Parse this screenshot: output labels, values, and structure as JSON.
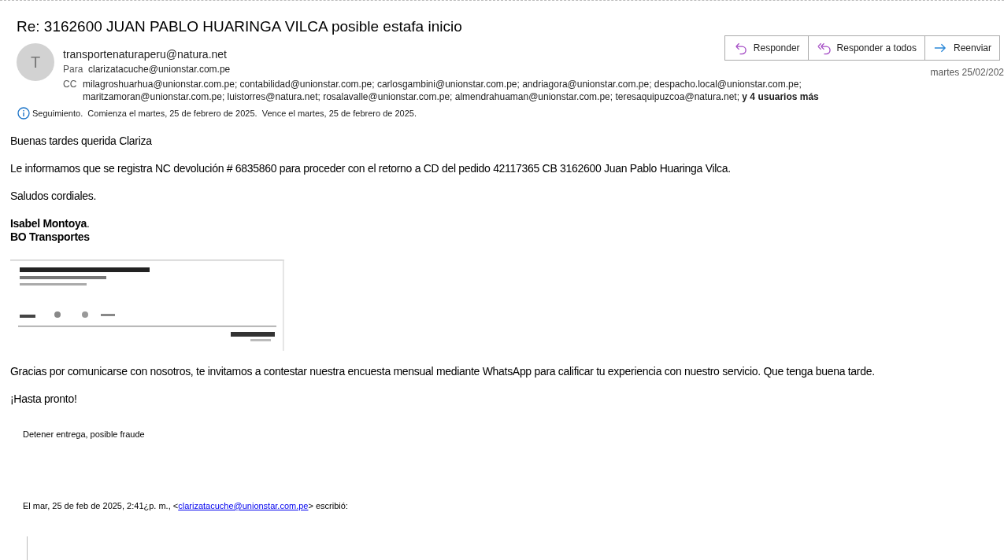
{
  "subject": "Re: 3162600 JUAN PABLO HUARINGA VILCA posible estafa inicio",
  "sender": {
    "avatar_letter": "T",
    "address": "transportenaturaperu@natura.net"
  },
  "to": {
    "label": "Para",
    "value": "clarizatacuche@unionstar.com.pe"
  },
  "cc": {
    "label": "CC",
    "lines": [
      "milagroshuarhua@unionstar.com.pe; contabilidad@unionstar.com.pe; carlosgambini@unionstar.com.pe; andriagora@unionstar.com.pe; despacho.local@unionstar.com.pe;",
      "maritzamoran@unionstar.com.pe; luistorres@natura.net; rosalavalle@unionstar.com.pe; almendrahuaman@unionstar.com.pe; teresaquipuzcoa@natura.net; **y 4 usuarios más**"
    ]
  },
  "actions": [
    {
      "kind": "reply",
      "label": "Responder"
    },
    {
      "kind": "reply_all",
      "label": "Responder a todos"
    },
    {
      "kind": "forward",
      "label": "Reenviar"
    }
  ],
  "date": "martes 25/02/202",
  "follow_up": "Seguimiento.  Comienza el martes, 25 de febrero de 2025.  Vence el martes, 25 de febrero de 2025.",
  "body": {
    "greeting": "Buenas tardes querida Clariza",
    "paragraphs": [
      "Le informamos que se registra NC devolución # 6835860 para proceder con el retorno a CD del pedido 42117365 CB 3162600 Juan Pablo Huaringa Vilca.",
      "Saludos cordiales."
    ],
    "signature": [
      "**Isabel Montoya**.",
      "**BO Transportes**"
    ],
    "signature_image": {
      "kind": "picture"
    },
    "closing": [
      "Gracias por comunicarse con nosotros, te invitamos a contestar nuestra encuesta mensual mediante WhatsApp para calificar tu experiencia con nuestro servicio. Que tenga buena tarde.",
      "¡Hasta pronto!"
    ]
  },
  "quoted": {
    "note": "Detener entrega, posible fraude",
    "header_before": "El mar, 25 de feb de 2025, 2:41¿p. m., <",
    "header_link": "clarizatacuche@unionstar.com.pe",
    "header_after": "> escribió:"
  }
}
